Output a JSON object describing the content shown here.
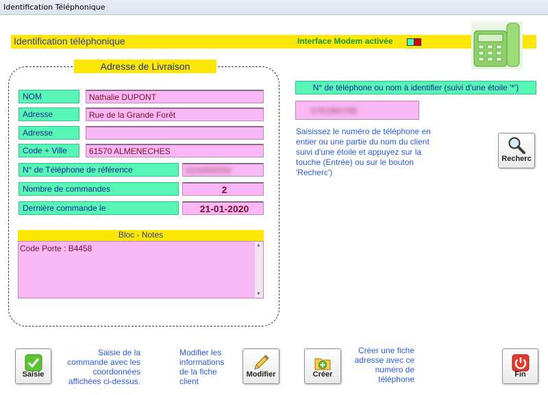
{
  "window": {
    "title": "Identification Téléphonique"
  },
  "header": {
    "title": "Identification téléphonique",
    "modem_status": "Interface Modem activée",
    "led_colors": [
      "#57f5b6",
      "#e00000"
    ]
  },
  "address_block": {
    "title": "Adresse de Livraison",
    "fields": [
      {
        "label": "NOM",
        "value": "Nathalie DUPONT"
      },
      {
        "label": "Adresse",
        "value": "Rue de la Grande Forêt"
      },
      {
        "label": "Adresse",
        "value": ""
      },
      {
        "label": "Code + Ville",
        "value": "61570 ALMENECHES"
      }
    ],
    "ref_phone_label": "N° de Téléphone de référence",
    "ref_phone_value": "0233000000",
    "orders_label": "Nombre de commandes",
    "orders_value": "2",
    "last_order_label": "Dernière commande le",
    "last_order_value": "21-01-2020"
  },
  "notes": {
    "title": "Bloc - Notes",
    "text": "Code Porte : B4458"
  },
  "search": {
    "label": "N° de téléphone ou nom à identifier (suivi d'une étoile '*')",
    "value": "0761660788",
    "help": "Saisissez le numéro de téléphone en entier ou une partie du nom du client suivi d'une étoile et appuyez sur la touche (Entrée) ou sur le bouton 'Recherc')",
    "button_label": "Recherc"
  },
  "footer": {
    "saisie_label": "Saisie",
    "saisie_desc": "Saisie de la commande avec les coordonnées affichées ci-dessus.",
    "modifier_label": "Modifier",
    "modifier_desc": "Modifier les informations de la fiche client",
    "creer_label": "Créer",
    "creer_desc": "Créer une fiche adresse avec ce numéro de téléphone",
    "fin_label": "Fin"
  },
  "colors": {
    "label_bg": "#57f5b6",
    "value_bg": "#f9b8f5",
    "banner": "#fbe605",
    "link_text": "#2a59d8"
  }
}
